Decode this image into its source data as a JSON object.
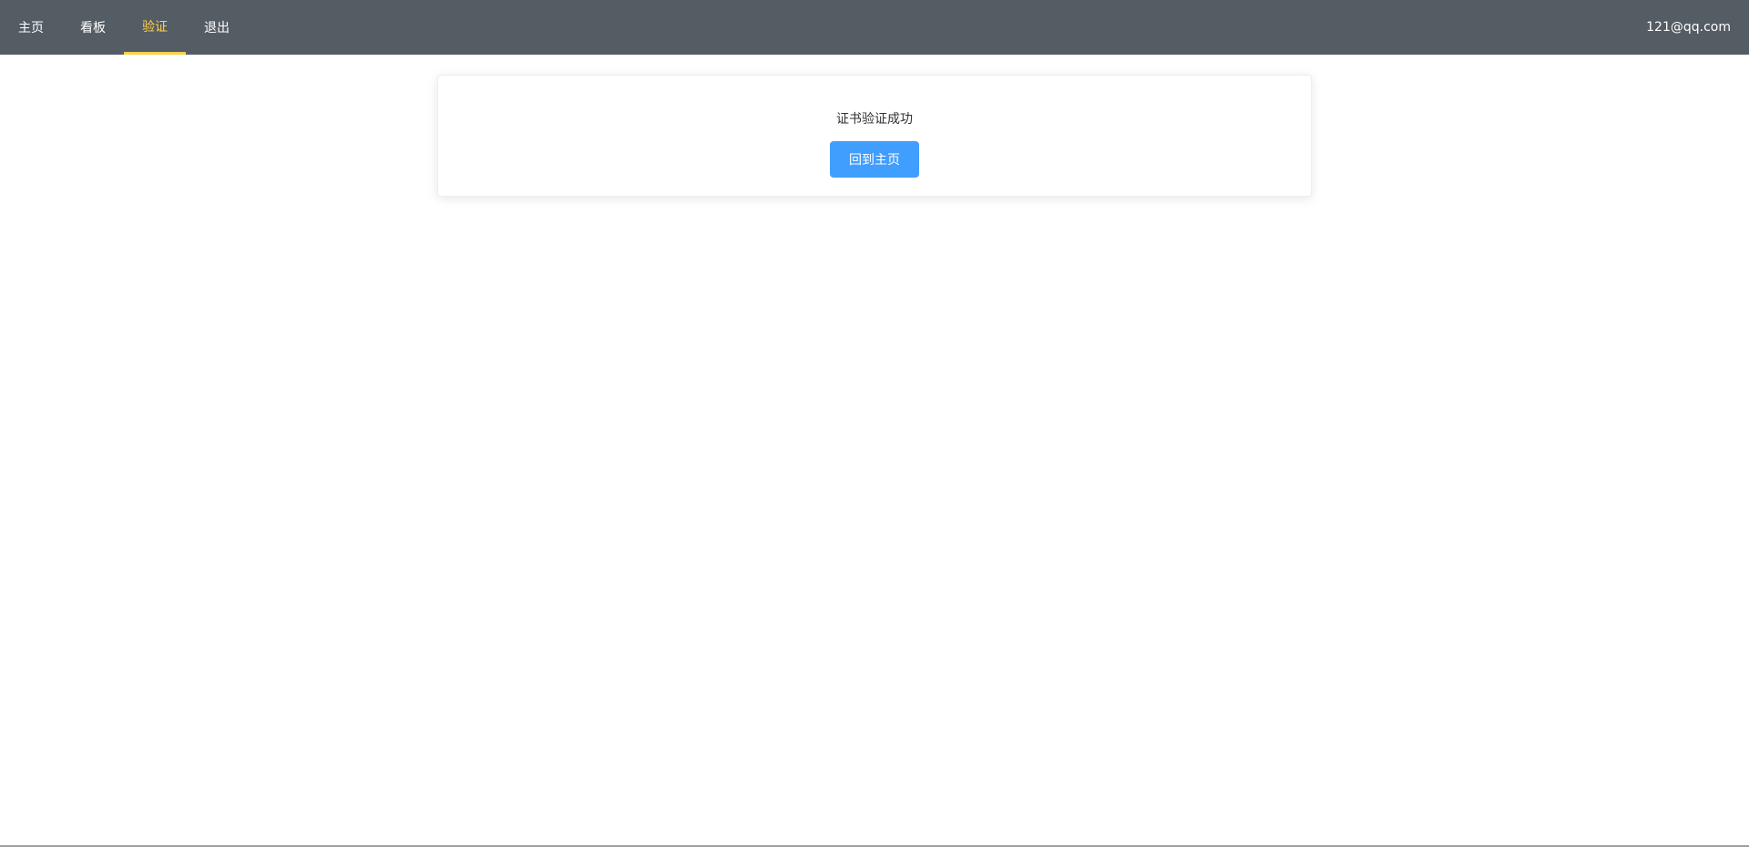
{
  "nav": {
    "items": [
      {
        "label": "主页",
        "active": false
      },
      {
        "label": "看板",
        "active": false
      },
      {
        "label": "验证",
        "active": true
      },
      {
        "label": "退出",
        "active": false
      }
    ],
    "user_email": "121@qq.com"
  },
  "result_card": {
    "message": "证书验证成功",
    "button_label": "回到主页"
  },
  "colors": {
    "nav_background": "#545c64",
    "nav_active": "#ffd04b",
    "primary_button": "#409eff"
  }
}
